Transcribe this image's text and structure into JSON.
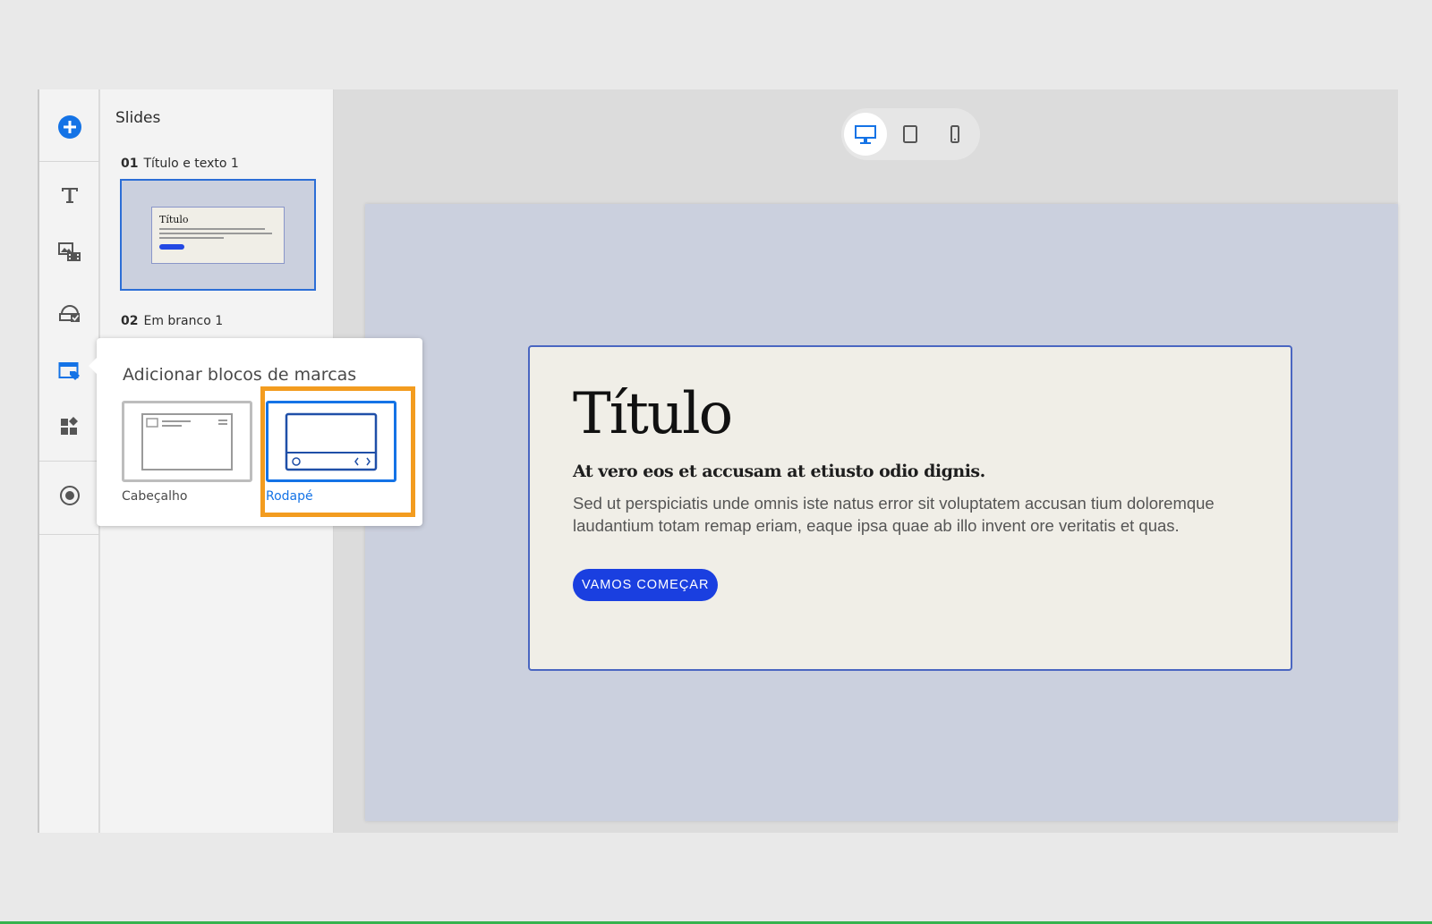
{
  "slides_panel": {
    "title": "Slides",
    "slides": [
      {
        "number": "01",
        "name": "Título e texto 1",
        "thumb_title": "Título"
      },
      {
        "number": "02",
        "name": "Em branco 1"
      }
    ]
  },
  "popover": {
    "title": "Adicionar blocos de marcas",
    "options": [
      {
        "label": "Cabeçalho",
        "selected": false
      },
      {
        "label": "Rodapé",
        "selected": true
      }
    ]
  },
  "slide": {
    "title": "Título",
    "subtitle": "At vero eos et accusam at etiusto odio dignis.",
    "body": "Sed ut perspiciatis unde omnis iste natus error sit voluptatem accusan tium doloremque laudantium totam remap eriam, eaque ipsa quae ab illo invent ore veritatis et quas.",
    "cta_label": "VAMOS COMEÇAR"
  },
  "device_toolbar": {
    "active": "desktop"
  },
  "colors": {
    "accent": "#1473e6",
    "cta": "#1a3fe0",
    "highlight": "#f39c1f",
    "canvas_bg": "#cbd0de",
    "card_bg": "#f0eee7"
  }
}
